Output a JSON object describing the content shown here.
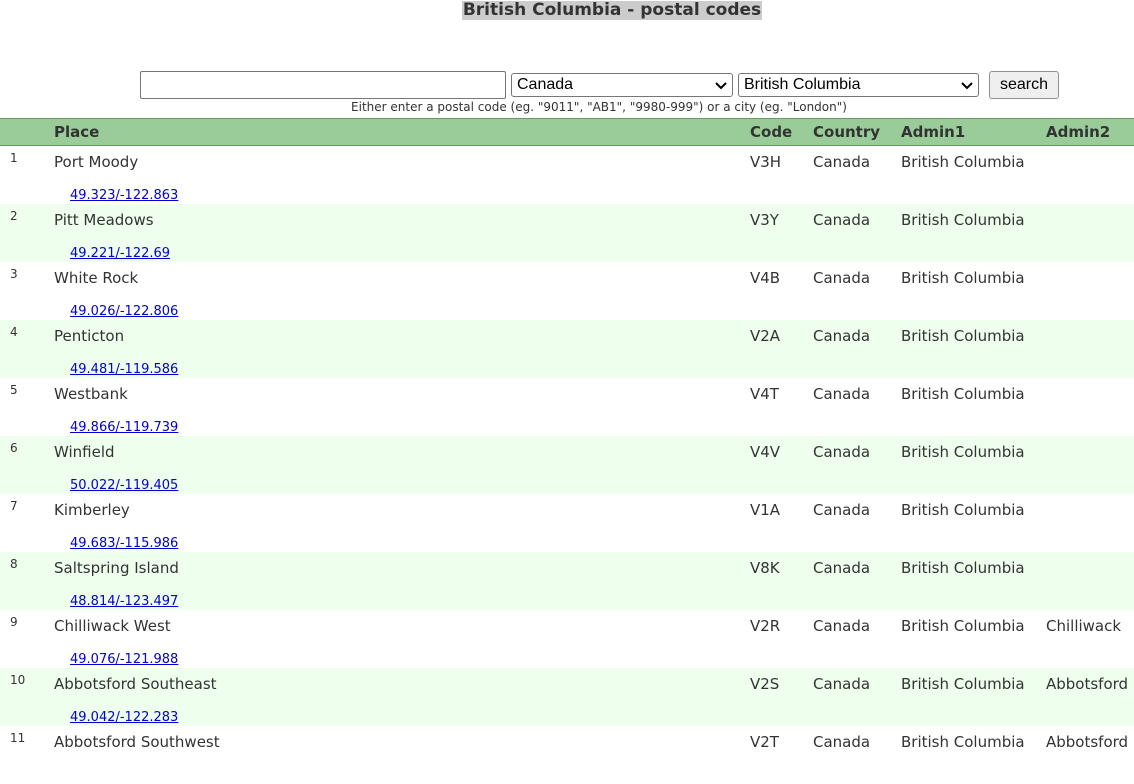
{
  "page": {
    "title": "British Columbia - postal codes"
  },
  "search": {
    "value": "",
    "placeholder": "",
    "country_selected": "Canada",
    "admin_selected": "British Columbia",
    "button_label": "search",
    "hint": "Either enter a postal code (eg. \"9011\", \"AB1\", \"9980-999\") or a city (eg. \"London\")"
  },
  "table": {
    "headers": {
      "num": "",
      "place": "Place",
      "code": "Code",
      "country": "Country",
      "admin1": "Admin1",
      "admin2": "Admin2"
    },
    "rows": [
      {
        "num": "1",
        "place": "Port Moody",
        "code": "V3H",
        "country": "Canada",
        "admin1": "British Columbia",
        "admin2": "",
        "coords": "49.323/-122.863"
      },
      {
        "num": "2",
        "place": "Pitt Meadows",
        "code": "V3Y",
        "country": "Canada",
        "admin1": "British Columbia",
        "admin2": "",
        "coords": "49.221/-122.69"
      },
      {
        "num": "3",
        "place": "White Rock",
        "code": "V4B",
        "country": "Canada",
        "admin1": "British Columbia",
        "admin2": "",
        "coords": "49.026/-122.806"
      },
      {
        "num": "4",
        "place": "Penticton",
        "code": "V2A",
        "country": "Canada",
        "admin1": "British Columbia",
        "admin2": "",
        "coords": "49.481/-119.586"
      },
      {
        "num": "5",
        "place": "Westbank",
        "code": "V4T",
        "country": "Canada",
        "admin1": "British Columbia",
        "admin2": "",
        "coords": "49.866/-119.739"
      },
      {
        "num": "6",
        "place": "Winfield",
        "code": "V4V",
        "country": "Canada",
        "admin1": "British Columbia",
        "admin2": "",
        "coords": "50.022/-119.405"
      },
      {
        "num": "7",
        "place": "Kimberley",
        "code": "V1A",
        "country": "Canada",
        "admin1": "British Columbia",
        "admin2": "",
        "coords": "49.683/-115.986"
      },
      {
        "num": "8",
        "place": "Saltspring Island",
        "code": "V8K",
        "country": "Canada",
        "admin1": "British Columbia",
        "admin2": "",
        "coords": "48.814/-123.497"
      },
      {
        "num": "9",
        "place": "Chilliwack West",
        "code": "V2R",
        "country": "Canada",
        "admin1": "British Columbia",
        "admin2": "Chilliwack",
        "coords": "49.076/-121.988"
      },
      {
        "num": "10",
        "place": "Abbotsford Southeast",
        "code": "V2S",
        "country": "Canada",
        "admin1": "British Columbia",
        "admin2": "Abbotsford",
        "coords": "49.042/-122.283"
      },
      {
        "num": "11",
        "place": "Abbotsford Southwest",
        "code": "V2T",
        "country": "Canada",
        "admin1": "British Columbia",
        "admin2": "Abbotsford",
        "coords": ""
      }
    ]
  }
}
